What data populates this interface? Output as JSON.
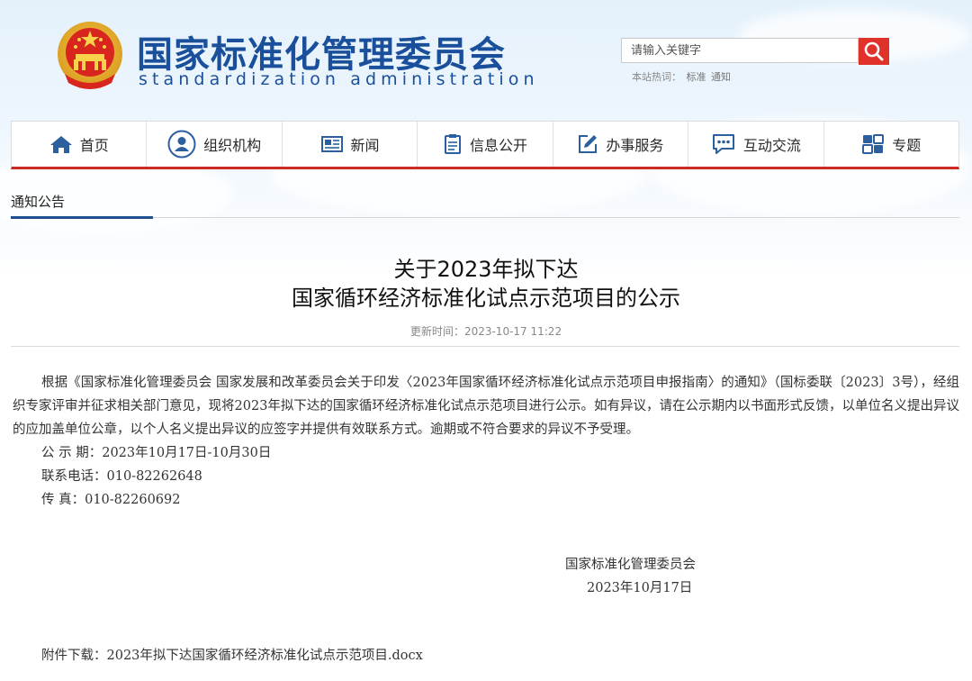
{
  "header": {
    "site_title": "国家标准化管理委员会",
    "site_subtitle": "standardization administration",
    "search_placeholder": "请输入关键字",
    "hot_label": "本站热词：",
    "hot_words": [
      "标准",
      "通知"
    ]
  },
  "nav": {
    "items": [
      {
        "label": "首页",
        "icon": "home-icon"
      },
      {
        "label": "组织机构",
        "icon": "user-icon"
      },
      {
        "label": "新闻",
        "icon": "newspaper-icon"
      },
      {
        "label": "信息公开",
        "icon": "clipboard-icon"
      },
      {
        "label": "办事服务",
        "icon": "edit-icon"
      },
      {
        "label": "互动交流",
        "icon": "chat-icon"
      },
      {
        "label": "专题",
        "icon": "topics-icon"
      }
    ]
  },
  "breadcrumb": {
    "label": "通知公告"
  },
  "article": {
    "title_line1": "关于2023年拟下达",
    "title_line2": "国家循环经济标准化试点示范项目的公示",
    "updated_label": "更新时间：",
    "updated_time": "2023-10-17 11:22",
    "paragraph": "根据《国家标准化管理委员会 国家发展和改革委员会关于印发〈2023年国家循环经济标准化试点示范项目申报指南〉的通知》（国标委联〔2023〕3号），经组织专家评审并征求相关部门意见，现将2023年拟下达的国家循环经济标准化试点示范项目进行公示。如有异议，请在公示期内以书面形式反馈，以单位名义提出异议的应加盖单位公章，以个人名义提出异议的应签字并提供有效联系方式。逾期或不符合要求的异议不予受理。",
    "period": "公 示 期：2023年10月17日-10月30日",
    "phone": "联系电话：010-82262648",
    "fax": "传 真：010-82260692",
    "signer": "国家标准化管理委员会",
    "sign_date": "2023年10月17日",
    "attachment_label": "附件下载：",
    "attachment_file": "2023年拟下达国家循环经济标准化试点示范项目.docx"
  },
  "colors": {
    "brand_blue": "#1a4f9c",
    "accent_red": "#cc2a24"
  }
}
